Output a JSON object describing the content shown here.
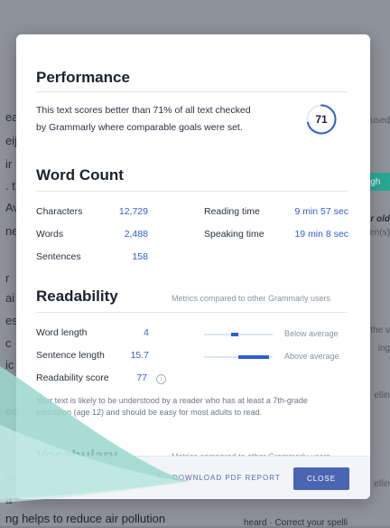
{
  "background": {
    "left_fragments": [
      "ea",
      "eij",
      "ir",
      ". t",
      "Av",
      "ne",
      "r",
      "ai",
      "es",
      "c",
      "ic",
      "ea",
      ". t",
      "e",
      ".s",
      "le",
      "a"
    ],
    "right_fragments": [
      "used",
      "er old",
      "en(s)",
      "the v",
      "ing",
      "ellin",
      "ellin"
    ],
    "teal_tab": "igh",
    "bottom_text": "ng helps to reduce air pollution",
    "bottom_right": "heard · Correct your spelli"
  },
  "performance": {
    "title": "Performance",
    "description_line1": "This text scores better than 71% of all text checked",
    "description_line2": "by Grammarly where comparable goals were set.",
    "score": "71",
    "score_fraction": 0.71
  },
  "word_count": {
    "title": "Word Count",
    "characters_label": "Characters",
    "characters_value": "12,729",
    "words_label": "Words",
    "words_value": "2,488",
    "sentences_label": "Sentences",
    "sentences_value": "158",
    "reading_time_label": "Reading time",
    "reading_time_value": "9 min 57 sec",
    "speaking_time_label": "Speaking time",
    "speaking_time_value": "19 min 8 sec"
  },
  "readability": {
    "title": "Readability",
    "subtitle": "Metrics compared to other Grammarly users",
    "word_length_label": "Word length",
    "word_length_value": "4",
    "word_length_status": "Below average",
    "sentence_length_label": "Sentence length",
    "sentence_length_value": "15.7",
    "sentence_length_status": "Above average",
    "score_label": "Readability score",
    "score_value": "77",
    "note_line1": "Your text is likely to be understood by a reader who has at least a 7th-grade",
    "note_line2": "education (age 12) and should be easy for most adults to read."
  },
  "vocabulary": {
    "title": "Vocabulary",
    "subtitle": "Metrics compared to other Grammarly users"
  },
  "footer": {
    "download_label": "DOWNLOAD PDF REPORT",
    "close_label": "CLOSE"
  },
  "colors": {
    "accent": "#2f5fd0",
    "button": "#4a66b2",
    "teal": "#2aa694"
  }
}
